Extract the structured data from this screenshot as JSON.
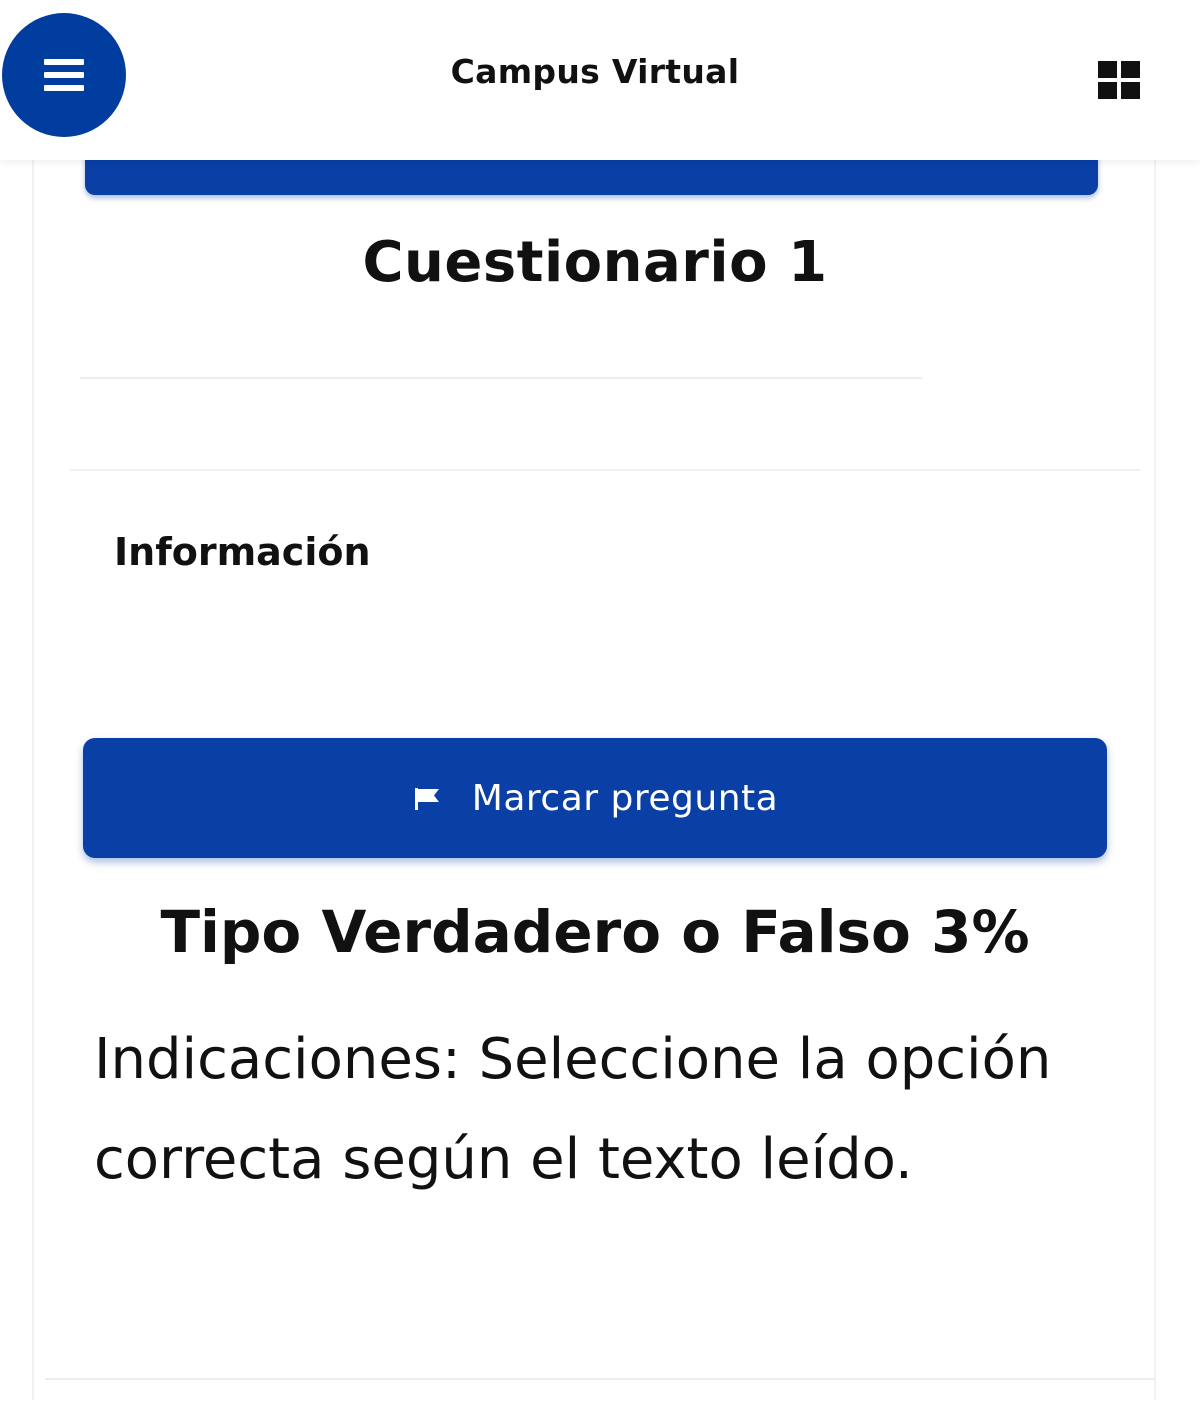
{
  "header": {
    "title": "Campus Virtual",
    "menu_icon": "hamburger-menu-icon",
    "apps_icon": "apps-grid-icon"
  },
  "quiz": {
    "title": "Cuestionario 1"
  },
  "question": {
    "info_heading": "Información",
    "flag_button_label": "Marcar pregunta",
    "flag_icon": "flag-icon",
    "type_title": "Tipo Verdadero o Falso 3%",
    "instructions": "Indicaciones: Seleccione la opción correcta según el texto leído."
  },
  "colors": {
    "primary": "#0a3fa6",
    "menu_button": "#003d9e",
    "text": "#111111",
    "background": "#ffffff"
  }
}
